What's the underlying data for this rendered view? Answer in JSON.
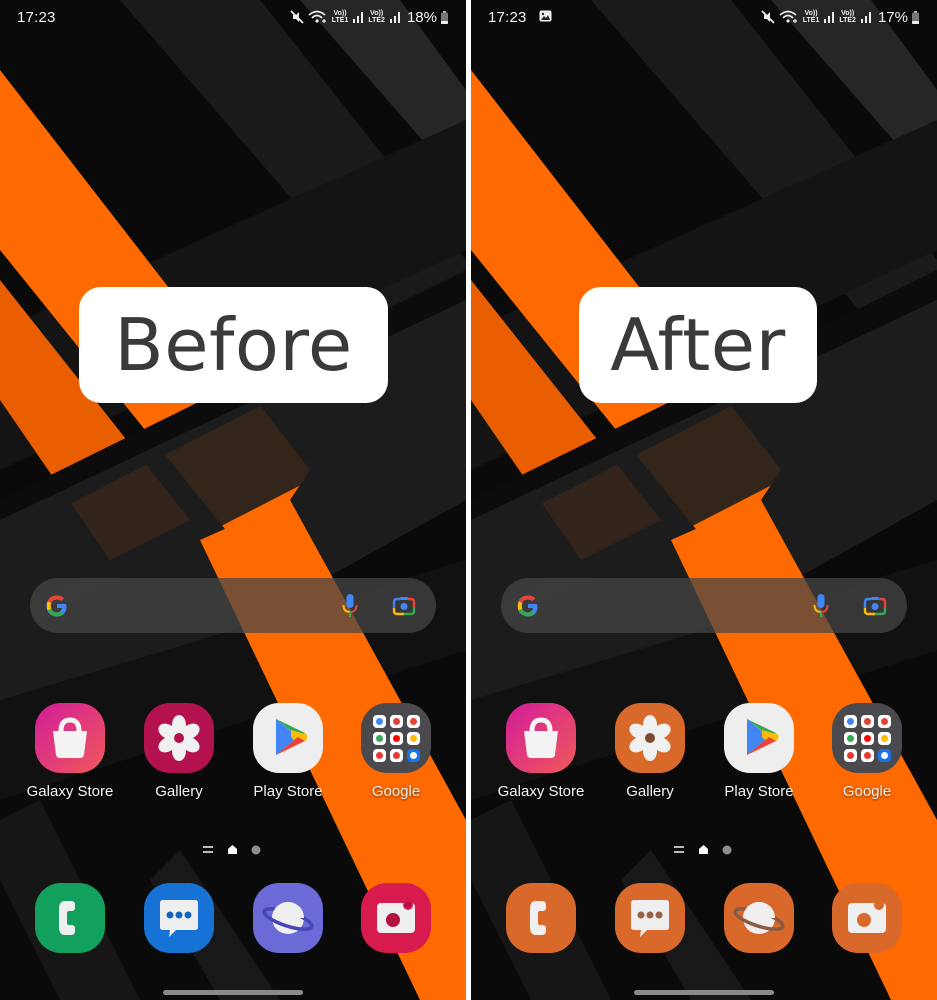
{
  "panels": [
    {
      "id": "before",
      "label": "Before",
      "status_bar": {
        "time": "17:23",
        "show_notification_icon": false,
        "sim1_label": "LTE1",
        "sim2_label": "LTE2",
        "volte_label": "Vo))",
        "battery_percent": "18%"
      },
      "search": {
        "icons": [
          "google-g-icon",
          "microphone-icon",
          "google-lens-icon"
        ]
      },
      "apps": [
        {
          "name": "Galaxy Store",
          "icon": "shopping-bag-icon",
          "bg": "#d21c9a",
          "bg2": "#f05a5a"
        },
        {
          "name": "Gallery",
          "icon": "flower-icon",
          "bg": "#b3124e",
          "center": "#b3124e"
        },
        {
          "name": "Play Store",
          "icon": "play-store-icon",
          "bg": "#eeeeee"
        },
        {
          "name": "Google",
          "icon": "folder-icon",
          "bg": "#4a4a4e"
        }
      ],
      "page_indicator": {
        "pages": 2,
        "current": "home"
      },
      "dock": [
        {
          "name": "Phone",
          "icon": "phone-icon",
          "bg": "#12a05c",
          "accent": "#12a05c"
        },
        {
          "name": "Messages",
          "icon": "chat-bubble-icon",
          "bg": "#1772d6",
          "accent": "#1565c0"
        },
        {
          "name": "Internet",
          "icon": "planet-icon",
          "bg": "#6b6ad6",
          "accent": "#4646b4"
        },
        {
          "name": "Camera",
          "icon": "camera-icon",
          "bg": "#d81b4f",
          "accent": "#b3123f"
        }
      ]
    },
    {
      "id": "after",
      "label": "After",
      "status_bar": {
        "time": "17:23",
        "show_notification_icon": true,
        "sim1_label": "LTE1",
        "sim2_label": "LTE2",
        "volte_label": "Vo))",
        "battery_percent": "17%"
      },
      "search": {
        "icons": [
          "google-g-icon",
          "microphone-icon",
          "google-lens-icon"
        ]
      },
      "apps": [
        {
          "name": "Galaxy Store",
          "icon": "shopping-bag-icon",
          "bg": "#d21c9a",
          "bg2": "#f05a5a"
        },
        {
          "name": "Gallery",
          "icon": "flower-icon",
          "bg": "#d9692a",
          "center": "#7a4a30"
        },
        {
          "name": "Play Store",
          "icon": "play-store-icon",
          "bg": "#eeeeee"
        },
        {
          "name": "Google",
          "icon": "folder-icon",
          "bg": "#4a4a4e"
        }
      ],
      "page_indicator": {
        "pages": 2,
        "current": "home"
      },
      "dock": [
        {
          "name": "Phone",
          "icon": "phone-icon",
          "bg": "#d9692a",
          "accent": "#d9692a"
        },
        {
          "name": "Messages",
          "icon": "chat-bubble-icon",
          "bg": "#d9692a",
          "accent": "#9a6048"
        },
        {
          "name": "Internet",
          "icon": "planet-icon",
          "bg": "#d9692a",
          "accent": "#8a5a44"
        },
        {
          "name": "Camera",
          "icon": "camera-icon",
          "bg": "#d9692a",
          "accent": "#d9692a"
        }
      ]
    }
  ],
  "colors": {
    "wallpaper_orange": "#ff6a00",
    "wallpaper_dark": "#0b0b0b",
    "theme_orange": "#d9692a"
  }
}
